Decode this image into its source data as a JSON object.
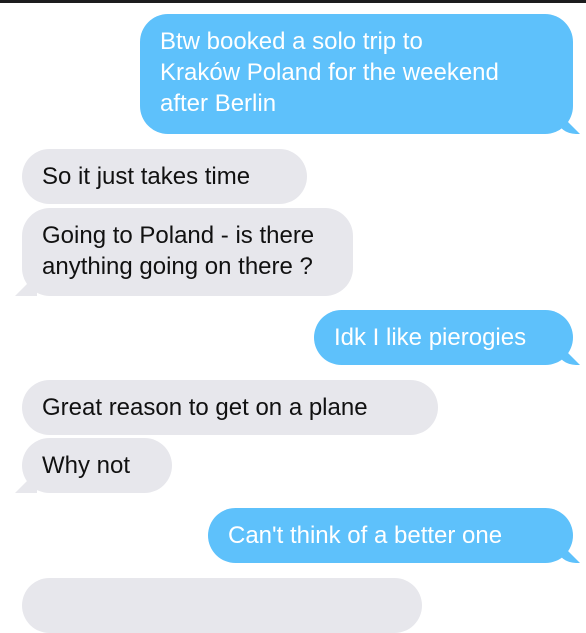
{
  "messages": [
    {
      "direction": "sent",
      "lines": [
        "Btw booked a solo trip to",
        "Kraków Poland for the weekend",
        "after Berlin"
      ]
    },
    {
      "direction": "received",
      "lines": [
        "So it just takes time"
      ]
    },
    {
      "direction": "received",
      "lines": [
        "Going to Poland - is there",
        "anything going on there ?"
      ]
    },
    {
      "direction": "sent",
      "lines": [
        "Idk I like pierogies"
      ]
    },
    {
      "direction": "received",
      "lines": [
        "Great reason to get on a plane"
      ]
    },
    {
      "direction": "received",
      "lines": [
        "Why not"
      ]
    },
    {
      "direction": "sent",
      "lines": [
        "Can't think of a better one"
      ]
    }
  ],
  "colors": {
    "sent_bubble": "#5ec1fb",
    "received_bubble": "#e7e7ec",
    "sent_text": "#ffffff",
    "received_text": "#111111"
  }
}
